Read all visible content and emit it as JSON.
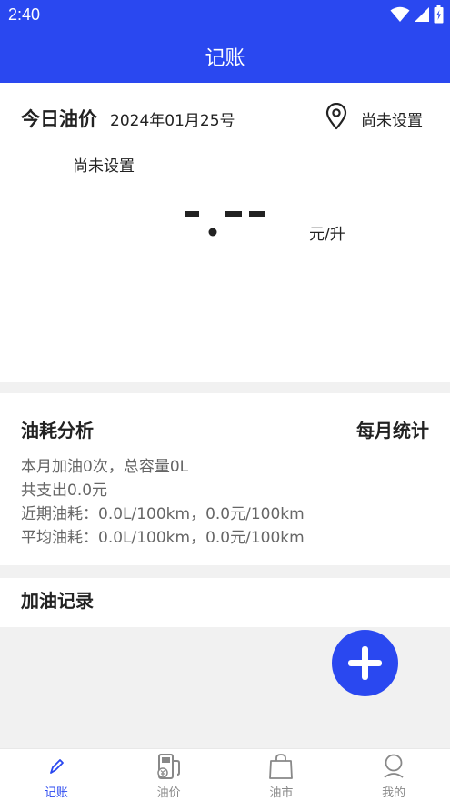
{
  "status_bar": {
    "time": "2:40"
  },
  "app_bar": {
    "title": "记账"
  },
  "price_card": {
    "title": "今日油价",
    "date": "2024年01月25号",
    "location_label": "尚未设置",
    "region_label": "尚未设置",
    "price_unit": "元/升"
  },
  "analysis": {
    "title": "油耗分析",
    "monthly_label": "每月统计",
    "lines": [
      "本月加油0次，总容量0L",
      "共支出0.0元",
      "近期油耗：0.0L/100km，0.0元/100km",
      "平均油耗：0.0L/100km，0.0元/100km"
    ]
  },
  "records": {
    "title": "加油记录"
  },
  "colors": {
    "accent": "#2a48f0"
  },
  "bottom_nav": {
    "items": [
      {
        "label": "记账",
        "icon": "edit-icon",
        "active": true
      },
      {
        "label": "油价",
        "icon": "fuel-pump-icon",
        "active": false
      },
      {
        "label": "油市",
        "icon": "shopping-bag-icon",
        "active": false
      },
      {
        "label": "我的",
        "icon": "user-icon",
        "active": false
      }
    ]
  }
}
